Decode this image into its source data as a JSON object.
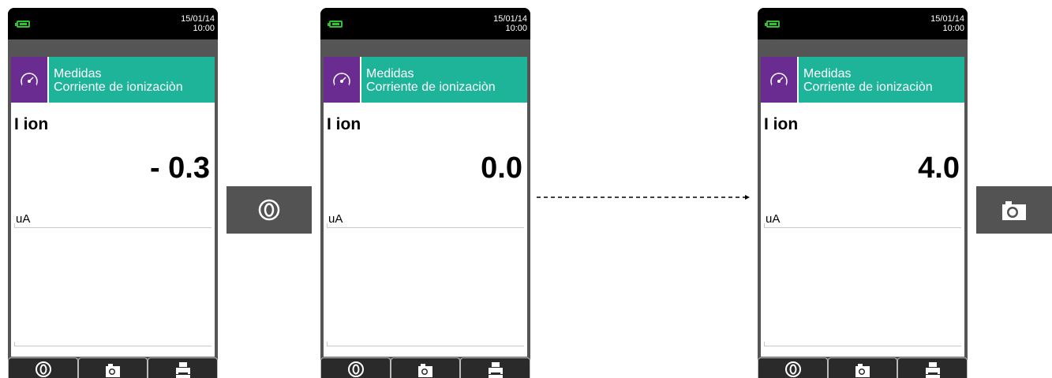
{
  "screens": [
    {
      "date": "15/01/14",
      "time": "10:00",
      "title": "Medidas",
      "subtitle": "Corriente de ionizaciòn",
      "param": "I ion",
      "value": "- 0.3",
      "unit": "uA"
    },
    {
      "date": "15/01/14",
      "time": "10:00",
      "title": "Medidas",
      "subtitle": "Corriente de ionizaciòn",
      "param": "I ion",
      "value": "0.0",
      "unit": "uA"
    },
    {
      "date": "15/01/14",
      "time": "10:00",
      "title": "Medidas",
      "subtitle": "Corriente de ionizaciòn",
      "param": "I ion",
      "value": "4.0",
      "unit": "uA"
    }
  ],
  "icons": {
    "battery": "battery-icon",
    "gauge": "gauge-icon",
    "zero": "zero-icon",
    "camera": "camera-icon",
    "printer": "printer-icon"
  },
  "colors": {
    "header": "#1db49a",
    "menu_icon_bg": "#6a2c91",
    "battery": "#2fc42f",
    "device_body": "#555555",
    "action_key": "#535353"
  }
}
